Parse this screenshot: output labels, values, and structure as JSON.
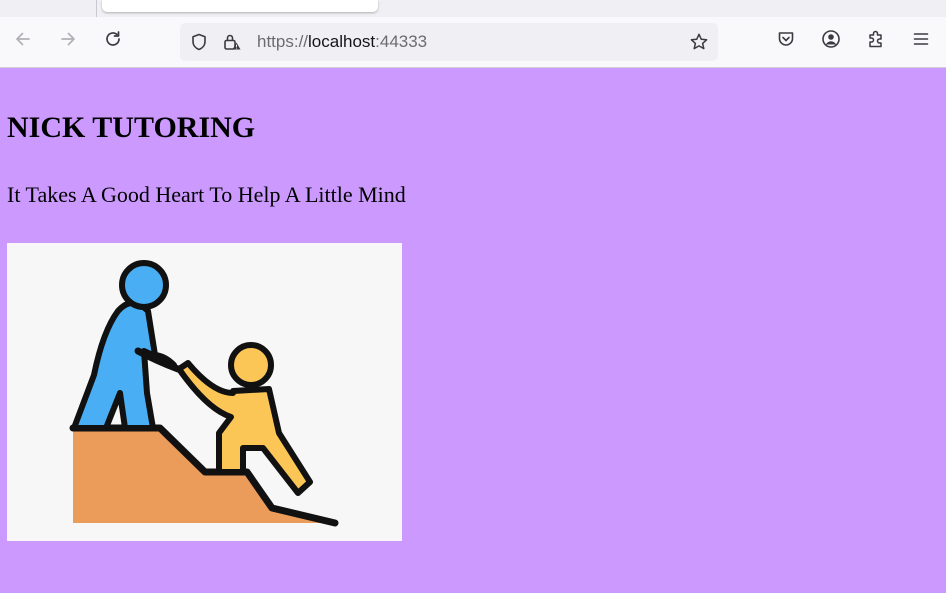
{
  "browser": {
    "url_scheme": "https://",
    "url_host": "localhost",
    "url_port": ":44333",
    "icons": {
      "back": "arrow-left-icon",
      "forward": "arrow-right-icon",
      "reload": "reload-icon",
      "tracking_protection": "shield-icon",
      "connection": "lock-warning-icon",
      "bookmark": "star-icon",
      "pocket": "pocket-icon",
      "account": "account-icon",
      "extensions": "puzzle-icon",
      "menu": "hamburger-menu-icon"
    }
  },
  "page": {
    "title": "NICK TUTORING",
    "tagline": "It Takes A Good Heart To Help A Little Mind",
    "image": "helping-hand-illustration",
    "background_color": "#cc99ff"
  }
}
